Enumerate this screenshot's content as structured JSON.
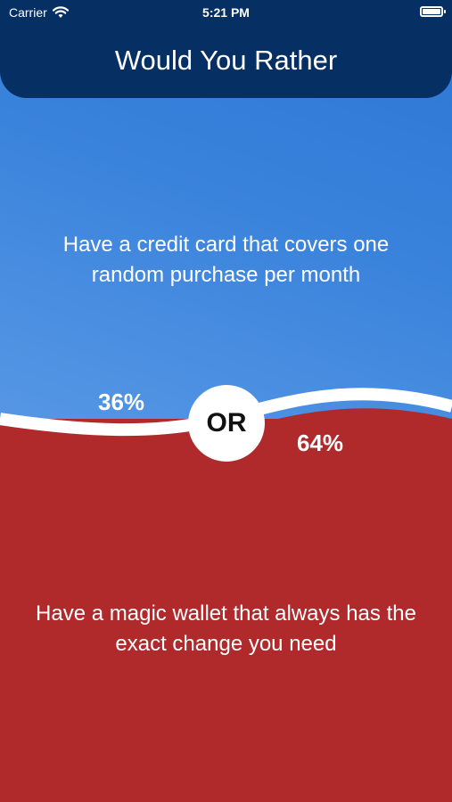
{
  "status_bar": {
    "carrier": "Carrier",
    "time": "5:21 PM"
  },
  "header": {
    "title": "Would You Rather"
  },
  "options": {
    "a": {
      "text": "Have a credit card that covers one random purchase per month",
      "percent": "36%",
      "color": "#3a83dc"
    },
    "b": {
      "text": "Have a magic wallet that always has the exact change you need",
      "percent": "64%",
      "color": "#b02a2c"
    }
  },
  "divider": {
    "label": "OR"
  },
  "icons": {
    "wifi": "wifi-icon",
    "battery": "battery-icon"
  },
  "colors": {
    "header": "#062f63",
    "divider": "#ffffff"
  }
}
